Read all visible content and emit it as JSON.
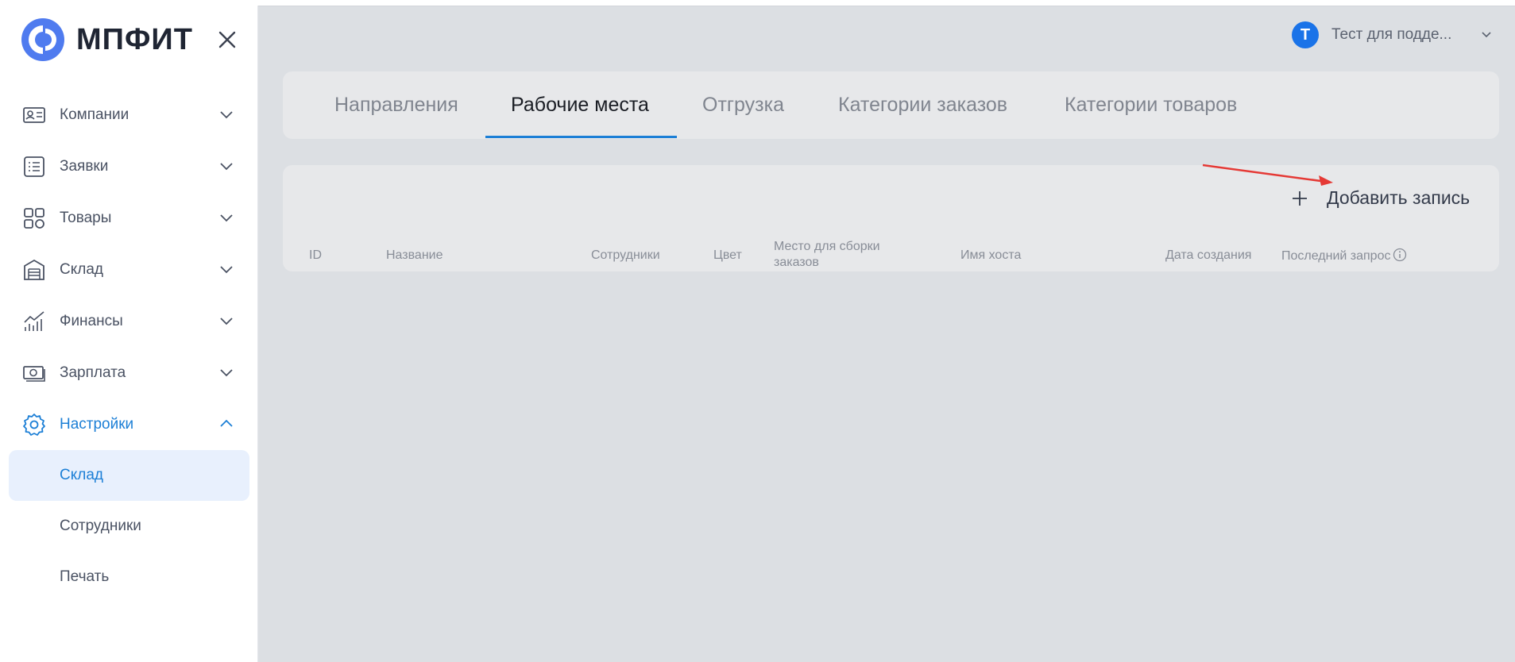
{
  "app": {
    "logo_text": "МПФИТ"
  },
  "colors": {
    "accent": "#1c7fd6",
    "avatar": "#1a73e8",
    "annotation_arrow": "#e53935"
  },
  "sidebar": {
    "items": [
      {
        "label": "Компании",
        "icon": "id-card-icon"
      },
      {
        "label": "Заявки",
        "icon": "list-icon"
      },
      {
        "label": "Товары",
        "icon": "grid-icon"
      },
      {
        "label": "Склад",
        "icon": "warehouse-icon"
      },
      {
        "label": "Финансы",
        "icon": "chart-icon"
      },
      {
        "label": "Зарплата",
        "icon": "money-icon"
      },
      {
        "label": "Настройки",
        "icon": "gear-icon",
        "expanded": true
      }
    ],
    "subitems": [
      {
        "label": "Склад",
        "selected": true
      },
      {
        "label": "Сотрудники"
      },
      {
        "label": "Печать"
      }
    ]
  },
  "header": {
    "avatar_letter": "Т",
    "user_name": "Тест для подде..."
  },
  "tabs": [
    {
      "label": "Направления"
    },
    {
      "label": "Рабочие места",
      "active": true
    },
    {
      "label": "Отгрузка"
    },
    {
      "label": "Категории заказов"
    },
    {
      "label": "Категории товаров"
    }
  ],
  "table": {
    "add_label": "Добавить запись",
    "columns": [
      "ID",
      "Название",
      "Сотрудники",
      "Цвет",
      "Место для сборки заказов",
      "Имя хоста",
      "Дата создания",
      "Последний запрос"
    ]
  }
}
